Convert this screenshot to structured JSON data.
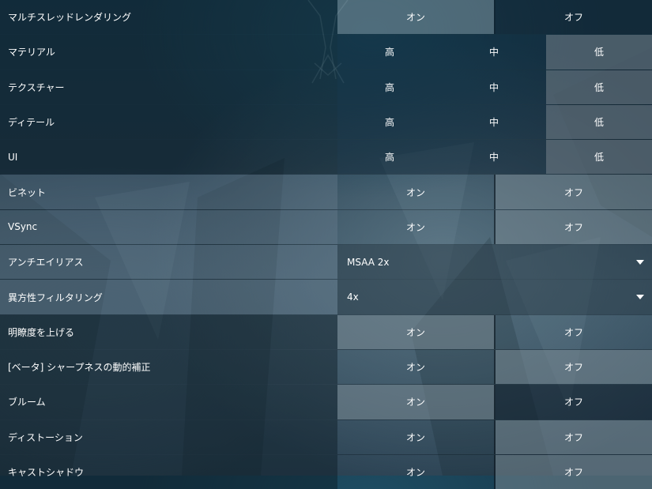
{
  "settings": [
    {
      "id": "multithread",
      "label": "マルチスレッドレンダリング",
      "type": "toggle",
      "options": [
        "オン",
        "オフ"
      ],
      "selected": 0
    },
    {
      "id": "material",
      "label": "マテリアル",
      "type": "quality",
      "options": [
        "高",
        "中",
        "低"
      ],
      "selected": 2
    },
    {
      "id": "texture",
      "label": "テクスチャー",
      "type": "quality",
      "options": [
        "高",
        "中",
        "低"
      ],
      "selected": 2
    },
    {
      "id": "detail",
      "label": "ディテール",
      "type": "quality",
      "options": [
        "高",
        "中",
        "低"
      ],
      "selected": 2
    },
    {
      "id": "ui",
      "label": "UI",
      "type": "quality",
      "options": [
        "高",
        "中",
        "低"
      ],
      "selected": 2
    },
    {
      "id": "vignette",
      "label": "ビネット",
      "type": "toggle",
      "options": [
        "オン",
        "オフ"
      ],
      "selected": 1
    },
    {
      "id": "vsync",
      "label": "VSync",
      "type": "toggle",
      "options": [
        "オン",
        "オフ"
      ],
      "selected": 1
    },
    {
      "id": "antialias",
      "label": "アンチエイリアス",
      "type": "dropdown",
      "value": "MSAA 2x"
    },
    {
      "id": "anisotropic",
      "label": "異方性フィルタリング",
      "type": "dropdown",
      "value": "4x"
    },
    {
      "id": "clarity",
      "label": "明瞭度を上げる",
      "type": "toggle",
      "options": [
        "オン",
        "オフ"
      ],
      "selected": 0
    },
    {
      "id": "sharpening",
      "label": "[ベータ] シャープネスの動的補正",
      "type": "toggle",
      "options": [
        "オン",
        "オフ"
      ],
      "selected": 1
    },
    {
      "id": "bloom",
      "label": "ブルーム",
      "type": "toggle",
      "options": [
        "オン",
        "オフ"
      ],
      "selected": 0
    },
    {
      "id": "distortion",
      "label": "ディストーション",
      "type": "toggle",
      "options": [
        "オン",
        "オフ"
      ],
      "selected": 1
    },
    {
      "id": "castshadow",
      "label": "キャストシャドウ",
      "type": "toggle",
      "options": [
        "オン",
        "オフ"
      ],
      "selected": 1
    }
  ],
  "icons": {
    "dropdown": "caret-down-icon"
  }
}
